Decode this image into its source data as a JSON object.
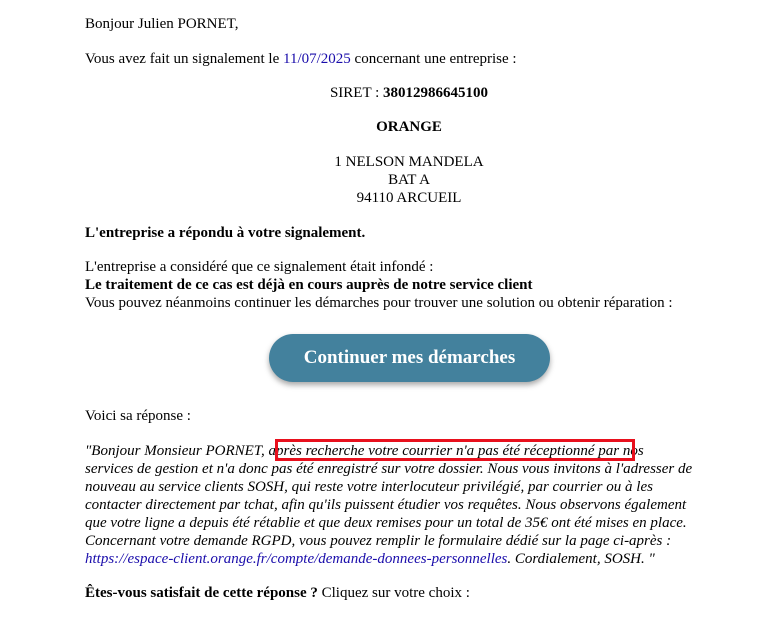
{
  "greeting": "Bonjour Julien PORNET,",
  "intro": {
    "before": "Vous avez fait un signalement le ",
    "date": "11/07/2025",
    "after": " concernant une entreprise :"
  },
  "company": {
    "siret_label": "SIRET : ",
    "siret": "38012986645100",
    "name": "ORANGE",
    "address_line1": "1 NELSON MANDELA",
    "address_line2": "BAT A",
    "address_line3": "94110 ARCUEIL"
  },
  "status": {
    "responded": "L'entreprise a répondu à votre signalement.",
    "considered": "L'entreprise a considéré que ce signalement était infondé :",
    "reason": "Le traitement de ce cas est déjà en cours auprès de notre service client",
    "continue_text": "Vous pouvez néanmoins continuer les démarches pour trouver une solution ou obtenir réparation :"
  },
  "button": {
    "label": "Continuer mes démarches"
  },
  "reply": {
    "intro": "Voici sa réponse :",
    "line1": "\"Bonjour Monsieur PORNET, après recherche votre courrier n'a pas été réceptionné par nos",
    "line2": "services de gestion et n'a donc pas été enregistré sur votre dossier. Nous vous invitons à l'adresser de",
    "line3": "nouveau au service clients SOSH, qui reste votre interlocuteur privilégié, par courrier ou à les",
    "line4": "contacter directement par tchat, afin qu'ils puissent étudier vos requêtes. Nous observons également",
    "line5": "que votre ligne a depuis été rétablie et que deux remises pour un total de 35€ ont été mises en place.",
    "line6": "Concernant votre demande RGPD, vous pouvez remplir le formulaire dédié sur la page ci-après :",
    "link": "https://espace-client.orange.fr/compte/demande-donnees-personnelles",
    "closing": ". Cordialement, SOSH. \""
  },
  "satisfaction": {
    "question": "Êtes-vous satisfait de cette réponse ?",
    "prompt": " Cliquez sur votre choix :"
  },
  "colors": {
    "button": "#43819d",
    "highlight": "#e8101d",
    "link": "#1a0dab"
  }
}
